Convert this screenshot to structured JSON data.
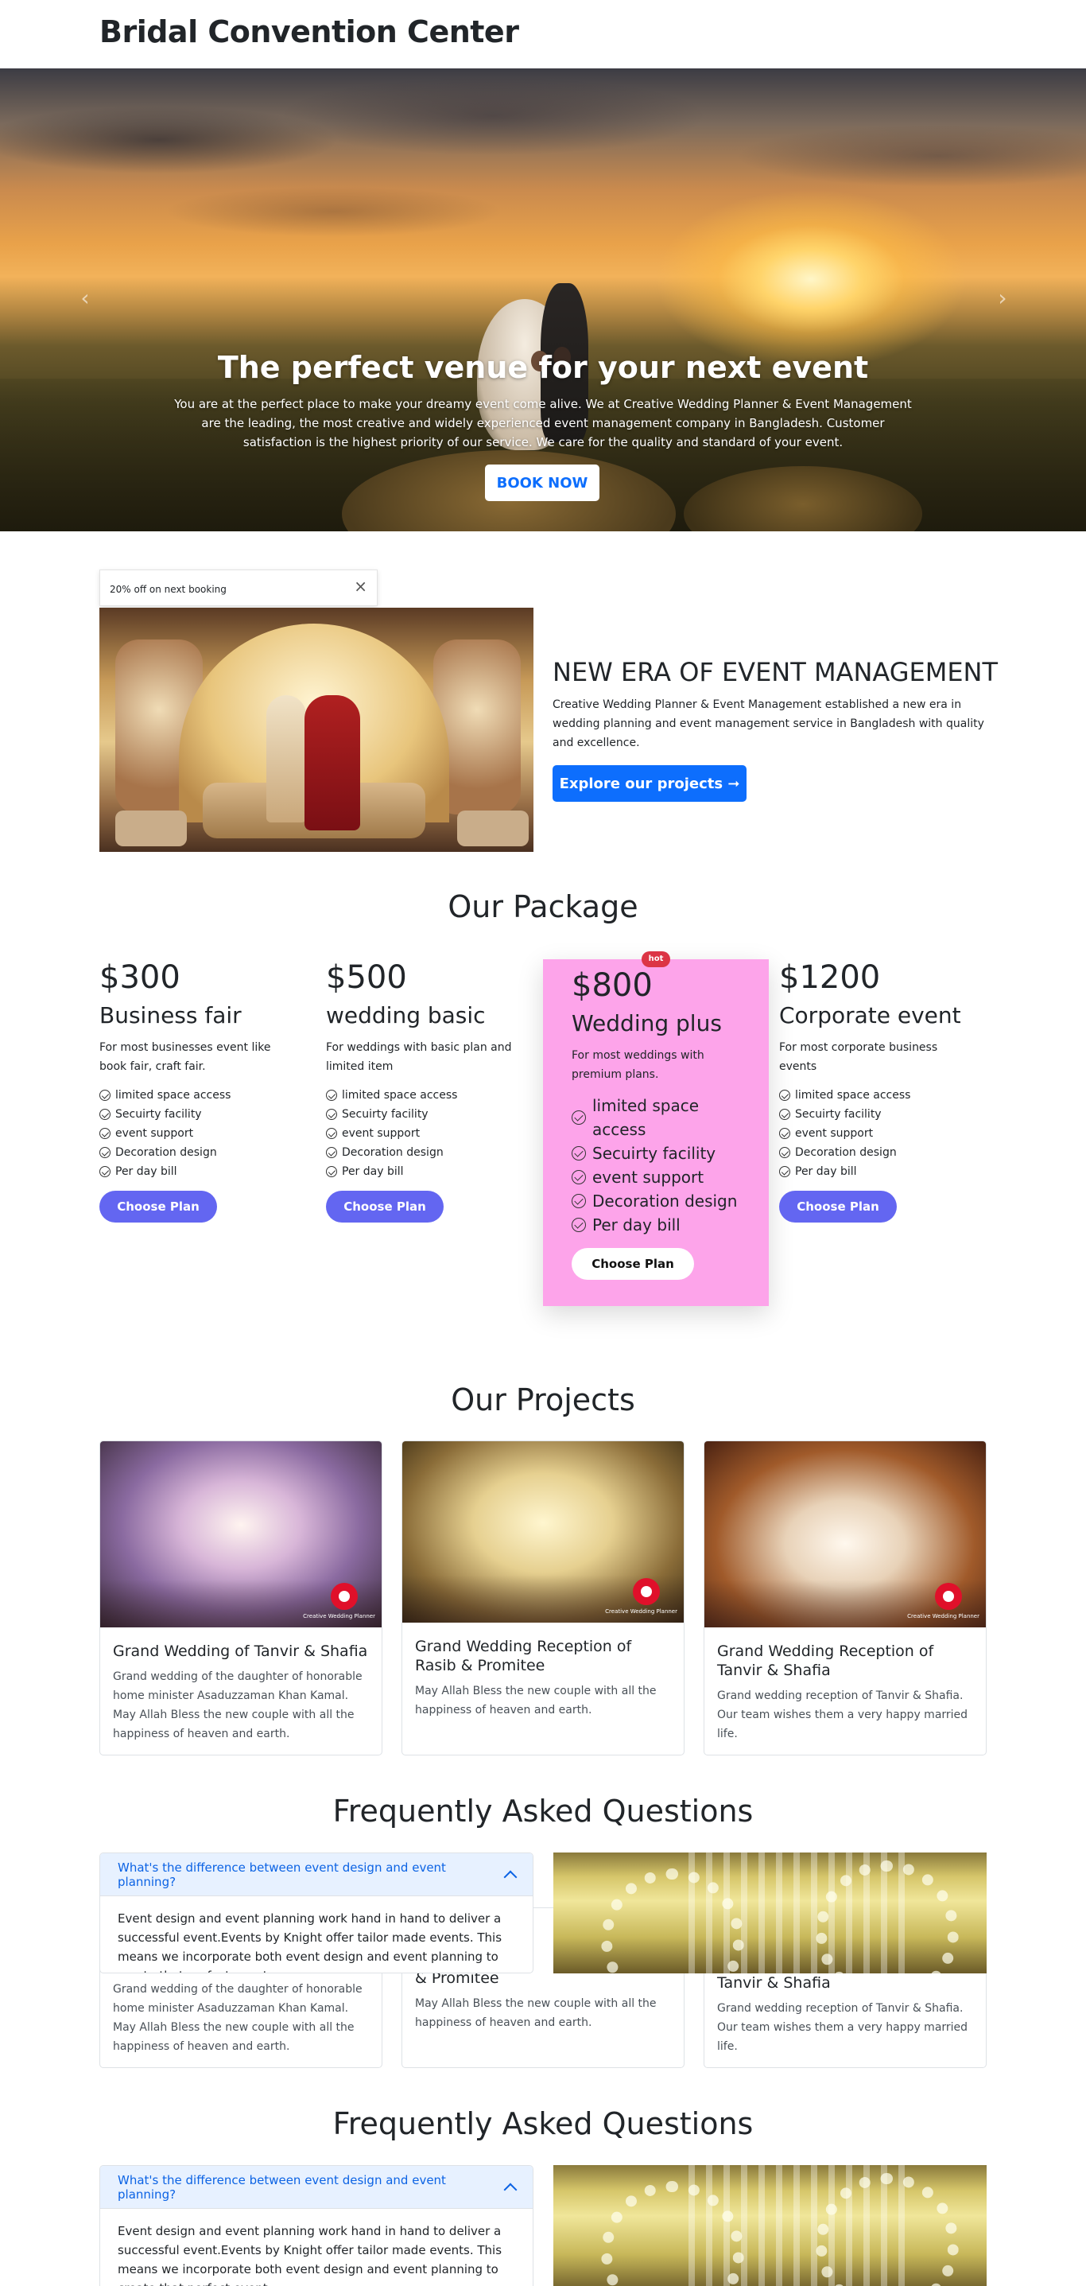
{
  "header": {
    "brand": "Bridal Convention Center"
  },
  "hero": {
    "title": "The perfect venue for your next event",
    "text": "You are at the perfect place to make your dreamy event come alive. We at Creative Wedding Planner & Event Management are the leading, the most creative and widely experienced event management company in Bangladesh. Customer satisfaction is the highest priority of our service. We care for the quality and standard of your event.",
    "button": "BOOK NOW",
    "prev_icon": "‹",
    "next_icon": "›"
  },
  "toast": {
    "text": "20% off on next booking",
    "close_icon": "×"
  },
  "about": {
    "title": "NEW ERA OF EVENT MANAGEMENT",
    "text": "Creative Wedding Planner & Event Management established a new era in wedding planning and event management service in Bangladesh with quality and excellence.",
    "button": "Explore our projects ➞"
  },
  "packages": {
    "title": "Our Package",
    "plans": [
      {
        "price": "$300",
        "name": "Business fair",
        "desc": "For most businesses event like book fair, craft fair.",
        "features": [
          "limited space access",
          "Secuirty facility",
          "event support",
          "Decoration design",
          "Per day bill"
        ],
        "button": "Choose Plan"
      },
      {
        "price": "$500",
        "name": "wedding basic",
        "desc": "For weddings with basic plan and limited item",
        "features": [
          "limited space access",
          "Secuirty facility",
          "event support",
          "Decoration design",
          "Per day bill"
        ],
        "button": "Choose Plan"
      },
      {
        "badge": "hot",
        "price": "$800",
        "name": "Wedding plus",
        "desc": "For most weddings with premium plans.",
        "features": [
          "limited space access",
          "Secuirty facility",
          "event support",
          "Decoration design",
          "Per day bill"
        ],
        "button": "Choose Plan"
      },
      {
        "price": "$1200",
        "name": "Corporate event",
        "desc": "For most corporate business events",
        "features": [
          "limited space access",
          "Secuirty facility",
          "event support",
          "Decoration design",
          "Per day bill"
        ],
        "button": "Choose Plan"
      }
    ]
  },
  "projects": {
    "title": "Our Projects",
    "logo_text": "Creative Wedding Planner",
    "items": [
      {
        "title": "Grand Wedding of Tanvir & Shafia",
        "text": "Grand wedding of the daughter of honorable home minister Asaduzzaman Khan Kamal. May Allah Bless the new couple with all the happiness of heaven and earth."
      },
      {
        "title": "Grand Wedding Reception of Rasib & Promitee",
        "text": "May Allah Bless the new couple with all the happiness of heaven and earth."
      },
      {
        "title": "Grand Wedding Reception of Tanvir & Shafia",
        "text": "Grand wedding reception of Tanvir & Shafia. Our team wishes them a very happy married life."
      }
    ]
  },
  "faq": {
    "title": "Frequently Asked Questions",
    "question": "What's the difference between event design and event planning?",
    "answer": "Event design and event planning work hand in hand to deliver a successful event.Events by Knight offer tailor made events. This means we incorporate both event design and event planning to create that perfect event."
  },
  "overlap": {
    "title_fragment_mid": "& Promitee",
    "title_fragment_right": "Tanvir & Shafia"
  }
}
